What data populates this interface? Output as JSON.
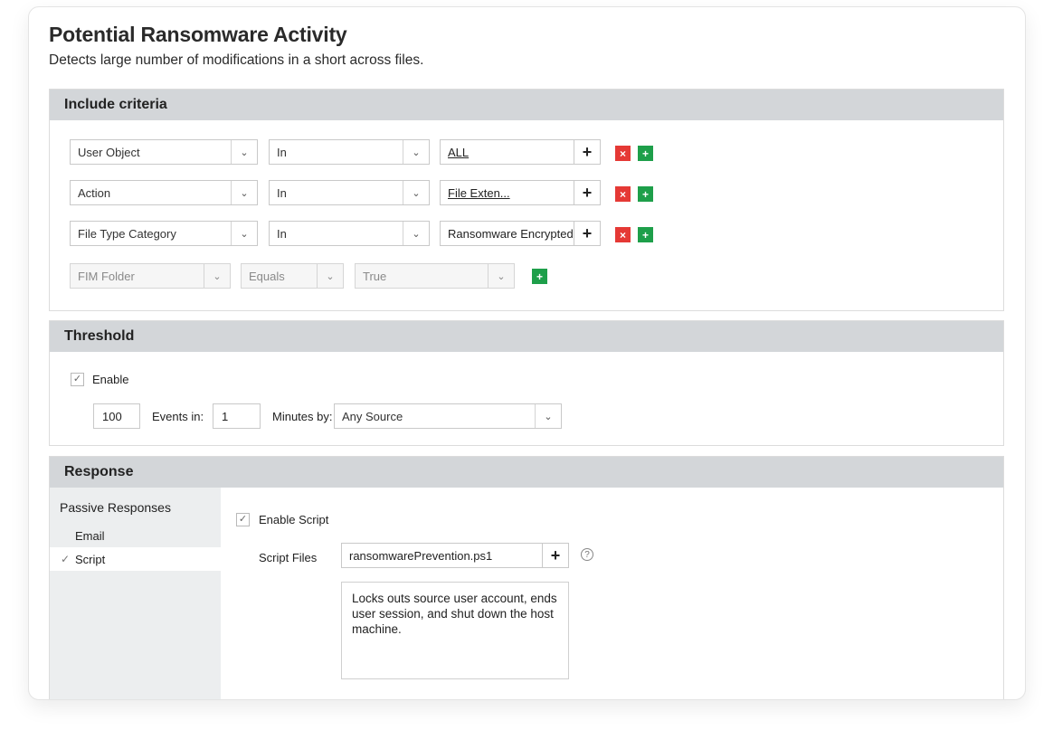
{
  "header": {
    "title": "Potential Ransomware Activity",
    "subtitle": "Detects large number of modifications in a short across files."
  },
  "include": {
    "heading": "Include criteria",
    "rows": [
      {
        "field": "User Object",
        "operator": "In",
        "value": "ALL",
        "value_link": true
      },
      {
        "field": "Action",
        "operator": "In",
        "value": "File Exten...",
        "value_link": true
      },
      {
        "field": "File Type Category",
        "operator": "In",
        "value": "Ransomware Encrypted",
        "value_link": false
      }
    ],
    "new_row": {
      "field": "FIM Folder",
      "operator": "Equals",
      "value": "True"
    },
    "plus": "+",
    "remove": "×",
    "add": "+"
  },
  "threshold": {
    "heading": "Threshold",
    "enable_label": "Enable",
    "count": "100",
    "events_label": "Events in:",
    "minutes": "1",
    "minutes_label": "Minutes by:",
    "source": "Any Source"
  },
  "response": {
    "heading": "Response",
    "side_title": "Passive Responses",
    "side_items": [
      {
        "label": "Email",
        "checked": false
      },
      {
        "label": "Script",
        "checked": true
      }
    ],
    "enable_script_label": "Enable Script",
    "script_files_label": "Script Files",
    "script_file": "ransomwarePrevention.ps1",
    "plus": "+",
    "help": "?",
    "description": "Locks outs source user account, ends user session, and shut down the host machine."
  },
  "icons": {
    "chevron": "chevron-down-icon",
    "check": "check-icon",
    "help": "help-circle-icon"
  },
  "colors": {
    "header_bg": "#d3d6d9",
    "remove_red": "#e53935",
    "add_green": "#1e9f4a",
    "sidebar_bg": "#eceeef"
  }
}
